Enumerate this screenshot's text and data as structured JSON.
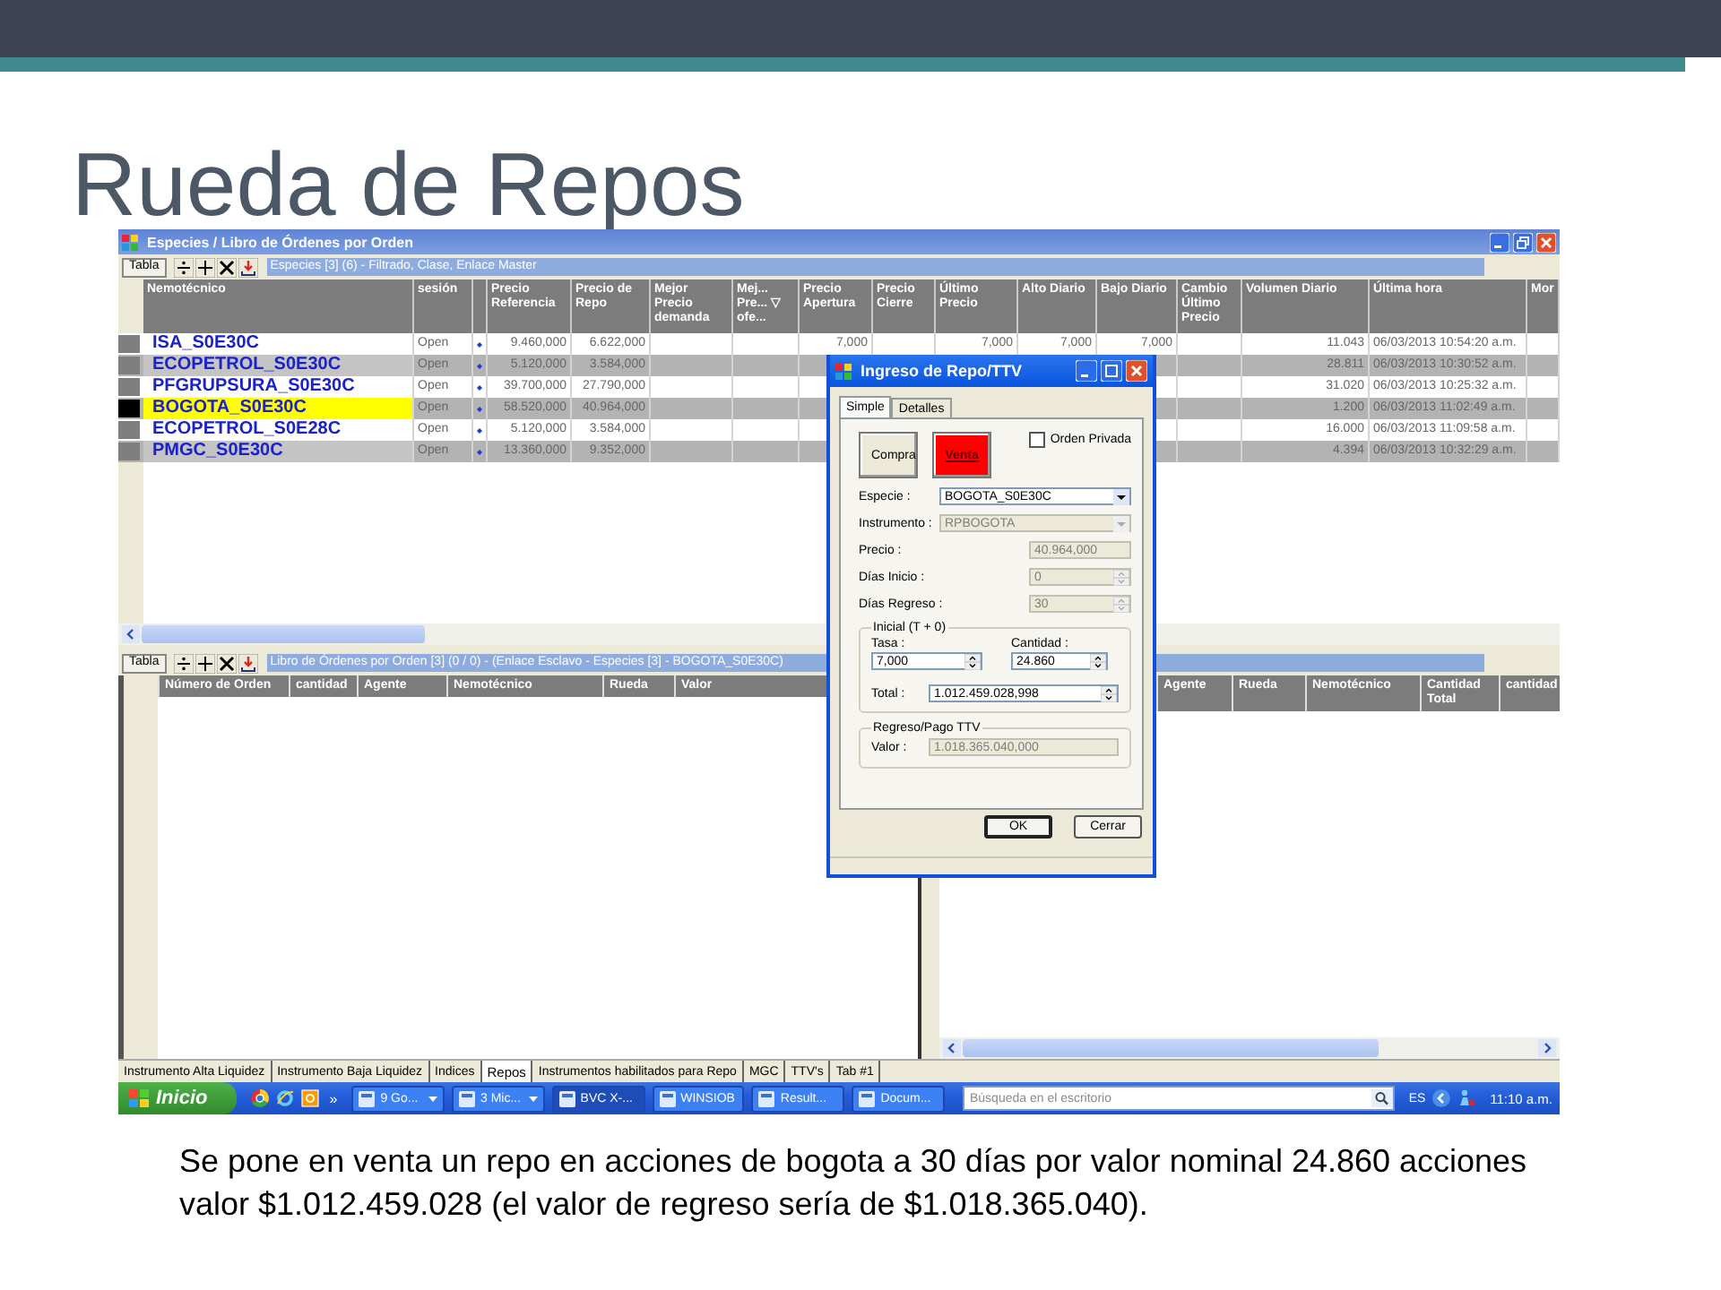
{
  "slide": {
    "title": "Rueda de Repos",
    "caption": "Se pone en venta un repo en acciones de bogota a 30 días por valor nominal 24.860 acciones valor $1.012.459.028 (el valor de regreso sería de $1.018.365.040)."
  },
  "window": {
    "title": "Especies / Libro de Órdenes por Orden",
    "upper_pane": {
      "toolbar": {
        "button": "Tabla",
        "caption": "Especies [3] (6) - Filtrado, Clase, Enlace Master"
      },
      "columns": [
        "Nemotécnico",
        "sesión",
        "Precio\nReferencia",
        "Precio de\nRepo",
        "Mejor\nPrecio\ndemanda",
        "Mej...\nPre... ▽\nofe...",
        "Precio\nApertura",
        "Precio\nCierre",
        "Último\nPrecio",
        "Alto Diario",
        "Bajo Diario",
        "Cambio\nÚltimo\nPrecio",
        "Volumen Diario",
        "Última hora",
        "Mor"
      ],
      "rows": [
        {
          "selected": false,
          "cells": [
            "ISA_S0E30C",
            "Open",
            "9.460,000",
            "6.622,000",
            null,
            null,
            "7,000",
            null,
            "7,000",
            "7,000",
            "7,000",
            null,
            "11.043",
            "06/03/2013 10:54:20 a.m.",
            null
          ]
        },
        {
          "selected": false,
          "cells": [
            "ECOPETROL_S0E30C",
            "Open",
            "5.120,000",
            "3.584,000",
            null,
            null,
            null,
            null,
            null,
            null,
            null,
            null,
            "28.811",
            "06/03/2013 10:30:52 a.m.",
            null
          ]
        },
        {
          "selected": false,
          "cells": [
            "PFGRUPSURA_S0E30C",
            "Open",
            "39.700,000",
            "27.790,000",
            null,
            null,
            null,
            null,
            null,
            null,
            null,
            null,
            "31.020",
            "06/03/2013 10:25:32 a.m.",
            null
          ]
        },
        {
          "selected": true,
          "cells": [
            "BOGOTA_S0E30C",
            "Open",
            "58.520,000",
            "40.964,000",
            null,
            null,
            null,
            null,
            null,
            null,
            null,
            null,
            "1.200",
            "06/03/2013 11:02:49 a.m.",
            null
          ]
        },
        {
          "selected": false,
          "cells": [
            "ECOPETROL_S0E28C",
            "Open",
            "5.120,000",
            "3.584,000",
            null,
            null,
            null,
            null,
            null,
            null,
            null,
            null,
            "16.000",
            "06/03/2013 11:09:58 a.m.",
            null
          ]
        },
        {
          "selected": false,
          "cells": [
            "PMGC_S0E30C",
            "Open",
            "13.360,000",
            "9.352,000",
            null,
            null,
            null,
            null,
            null,
            null,
            null,
            null,
            "4.394",
            "06/03/2013 10:32:29 a.m.",
            null
          ]
        }
      ]
    },
    "lower_pane": {
      "toolbar": {
        "button": "Tabla",
        "caption": "Libro de Órdenes por Orden [3] (0 / 0) - (Enlace Esclavo - Especies [3] - BOGOTA_S0E30C)"
      },
      "left_columns": [
        "Número de Orden",
        "cantidad",
        "Agente",
        "Nemotécnico",
        "Rueda",
        "Valor"
      ],
      "right_columns": [
        "Agente",
        "Rueda",
        "Nemotécnico",
        "Cantidad\nTotal",
        "cantidad"
      ]
    },
    "bottom_tabs": [
      {
        "label": "Instrumento Alta Liquidez",
        "selected": false
      },
      {
        "label": "Instrumento Baja Liquidez",
        "selected": false
      },
      {
        "label": "Indices",
        "selected": false
      },
      {
        "label": "Repos",
        "selected": true
      },
      {
        "label": "Instrumentos habilitados para Repo",
        "selected": false
      },
      {
        "label": "MGC",
        "selected": false
      },
      {
        "label": "TTV's",
        "selected": false
      },
      {
        "label": "Tab #1",
        "selected": false
      }
    ]
  },
  "dialog": {
    "title": "Ingreso de Repo/TTV",
    "tabs": [
      {
        "label": "Simple",
        "selected": true
      },
      {
        "label": "Detalles",
        "selected": false
      }
    ],
    "side_buttons": [
      {
        "label": "Compra",
        "selected": false
      },
      {
        "label": "Venta",
        "selected": true
      }
    ],
    "private_order": {
      "label": "Orden Privada",
      "checked": false
    },
    "fields": [
      {
        "label": "Especie :",
        "value": "BOGOTA_S0E30C",
        "kind": "dropdown",
        "disabled": false
      },
      {
        "label": "Instrumento :",
        "value": "RPBOGOTA",
        "kind": "dropdown",
        "disabled": true
      },
      {
        "label": "Precio :",
        "value": "40.964,000",
        "kind": "text",
        "disabled": true
      },
      {
        "label": "Días Inicio :",
        "value": "0",
        "kind": "spinner",
        "disabled": true
      },
      {
        "label": "Días Regreso :",
        "value": "30",
        "kind": "spinner",
        "disabled": true
      }
    ],
    "initial_group": {
      "title": "Inicial (T + 0)",
      "rate": {
        "label": "Tasa :",
        "value": "7,000"
      },
      "quantity": {
        "label": "Cantidad :",
        "value": "24.860"
      },
      "total": {
        "label": "Total :",
        "value": "1.012.459.028,998"
      }
    },
    "return_group": {
      "title": "Regreso/Pago TTV",
      "value_field": {
        "label": "Valor :",
        "value": "1.018.365.040,000",
        "disabled": true
      }
    },
    "buttons": [
      "OK",
      "Cerrar"
    ]
  },
  "taskbar": {
    "start": "Inicio",
    "overflow": "»",
    "tasks": [
      {
        "label": "9 Go...",
        "selected": false,
        "menu": true
      },
      {
        "label": "3 Mic...",
        "selected": false,
        "menu": true
      },
      {
        "label": "BVC X-...",
        "selected": true,
        "menu": false
      },
      {
        "label": "WINSIOB",
        "selected": false,
        "menu": false
      },
      {
        "label": "Result...",
        "selected": false,
        "menu": false
      },
      {
        "label": "Docum...",
        "selected": false,
        "menu": false
      }
    ],
    "search": {
      "placeholder": "Búsqueda en el escritorio"
    },
    "language": "ES",
    "clock": "11:10 a.m."
  }
}
